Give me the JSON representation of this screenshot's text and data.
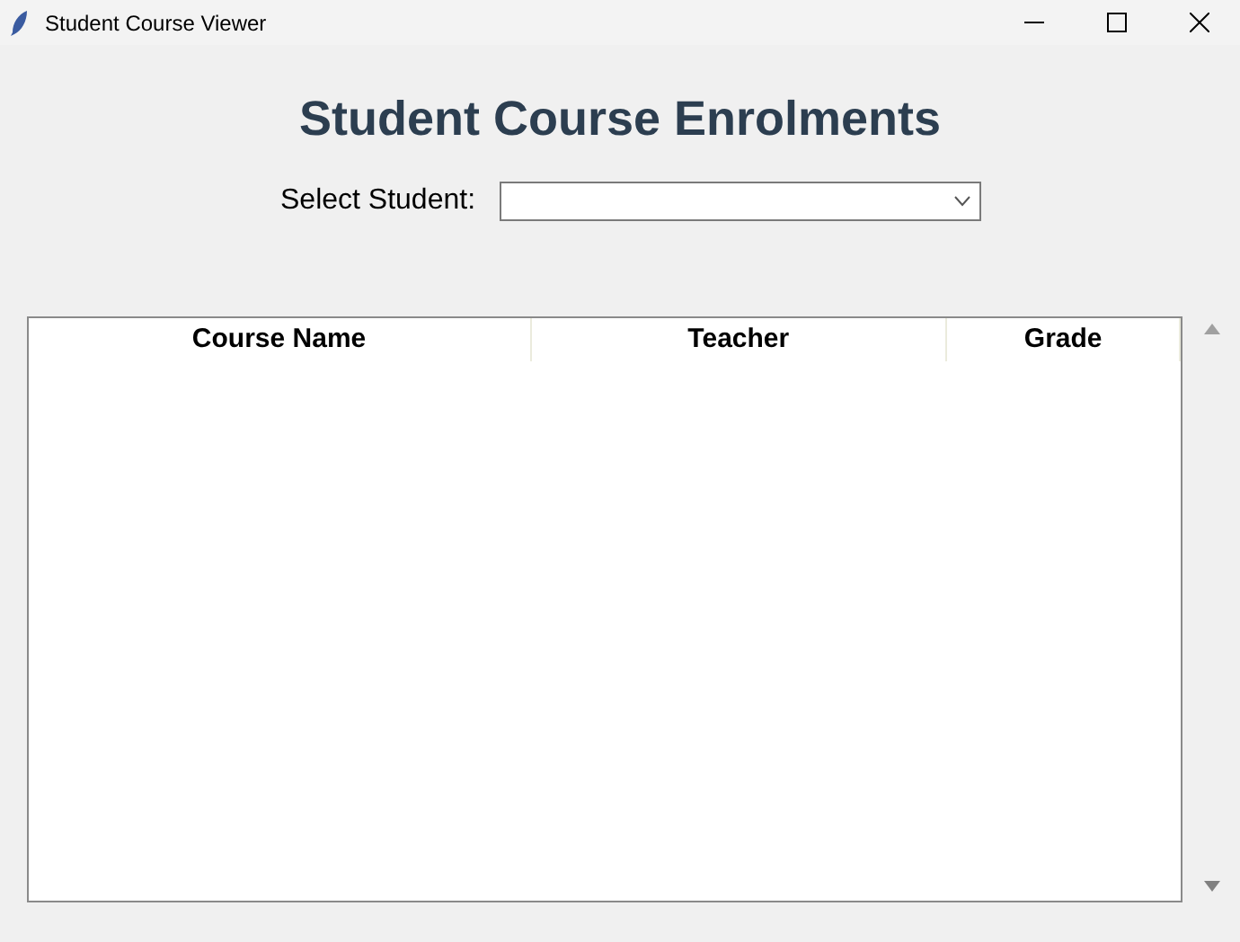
{
  "window": {
    "title": "Student Course Viewer"
  },
  "heading": "Student Course Enrolments",
  "student_select": {
    "label": "Select Student:"
  },
  "table": {
    "columns": [
      "Course Name",
      "Teacher",
      "Grade"
    ]
  }
}
